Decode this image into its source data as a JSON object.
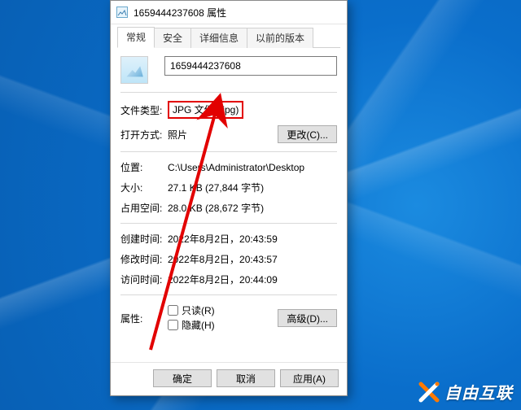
{
  "titlebar": {
    "title": "1659444237608 属性"
  },
  "tabs": {
    "general": "常规",
    "security": "安全",
    "details": "详细信息",
    "previous": "以前的版本"
  },
  "general": {
    "filename": "1659444237608",
    "filetype_label": "文件类型:",
    "filetype_value": "JPG 文件 (.jpg)",
    "opens_with_label": "打开方式:",
    "opens_with_value": "照片",
    "change_button": "更改(C)...",
    "location_label": "位置:",
    "location_value": "C:\\Users\\Administrator\\Desktop",
    "size_label": "大小:",
    "size_value": "27.1 KB (27,844 字节)",
    "size_on_disk_label": "占用空间:",
    "size_on_disk_value": "28.0 KB (28,672 字节)",
    "created_label": "创建时间:",
    "created_value": "2022年8月2日，20:43:59",
    "modified_label": "修改时间:",
    "modified_value": "2022年8月2日，20:43:57",
    "accessed_label": "访问时间:",
    "accessed_value": "2022年8月2日，20:44:09",
    "attributes_label": "属性:",
    "readonly_label": "只读(R)",
    "hidden_label": "隐藏(H)",
    "advanced_button": "高级(D)..."
  },
  "buttons": {
    "ok": "确定",
    "cancel": "取消",
    "apply": "应用(A)"
  },
  "watermark": {
    "text": "自由互联"
  }
}
